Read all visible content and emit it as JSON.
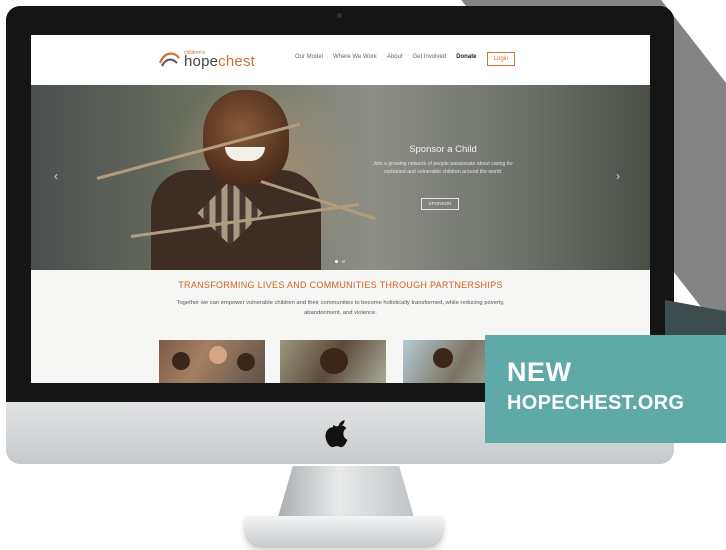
{
  "nav": {
    "logo_prefix": "hope",
    "logo_suffix": "chest",
    "logo_small": "children's",
    "items": [
      "Our Model",
      "Where We Work",
      "About",
      "Get Involved"
    ],
    "donate": "Donate",
    "login": "Login"
  },
  "hero": {
    "title": "Sponsor a Child",
    "copy": "Join a growing network of people passionate about caring for orphaned and vulnerable children around the world.",
    "button": "SPONSOR",
    "prev": "‹",
    "next": "›"
  },
  "section": {
    "title": "TRANSFORMING LIVES AND COMMUNITIES THROUGH PARTNERSHIPS",
    "copy": "Together we can empower vulnerable children and their communities to become holistically transformed, while reducing poverty, abandonment, and violence."
  },
  "badge": {
    "line1": "NEW",
    "line2": "HOPECHEST.ORG"
  },
  "colors": {
    "accent": "#d07135",
    "badge": "#5faaa9"
  }
}
